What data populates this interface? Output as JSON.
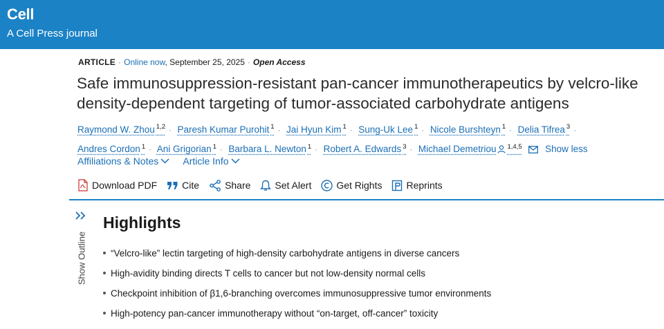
{
  "header": {
    "brand": "Cell",
    "subtitle": "A Cell Press journal",
    "bg_color": "#1b82c6"
  },
  "meta": {
    "type": "ARTICLE",
    "online_label": "Online now",
    "date": ", September 25, 2025",
    "access": "Open Access"
  },
  "title": "Safe immunosuppression-resistant pan-cancer immunotherapeutics by velcro-like density-dependent targeting of tumor-associated carbohydrate antigens",
  "authors": [
    {
      "name": "Raymond W. Zhou",
      "aff": "1,2"
    },
    {
      "name": "Paresh Kumar Purohit",
      "aff": "1"
    },
    {
      "name": "Jai Hyun Kim",
      "aff": "1"
    },
    {
      "name": "Sung-Uk Lee",
      "aff": "1"
    },
    {
      "name": "Nicole Burshteyn",
      "aff": "1"
    },
    {
      "name": "Delia Tifrea",
      "aff": "3"
    },
    {
      "name": "Andres Cordon",
      "aff": "1"
    },
    {
      "name": "Ani Grigorian",
      "aff": "1"
    },
    {
      "name": "Barbara L. Newton",
      "aff": "1"
    },
    {
      "name": "Robert A. Edwards",
      "aff": "3"
    },
    {
      "name": "Michael Demetriou",
      "aff": "1,4,5"
    }
  ],
  "show_less": "Show less",
  "links": {
    "affiliations": "Affiliations & Notes",
    "article_info": "Article Info"
  },
  "tools": {
    "download_pdf": "Download PDF",
    "cite": "Cite",
    "share": "Share",
    "set_alert": "Set Alert",
    "get_rights": "Get Rights",
    "reprints": "Reprints"
  },
  "outline": {
    "label": "Show Outline",
    "toggle_icon": "double-chevron-right-icon"
  },
  "highlights": {
    "title": "Highlights",
    "items": [
      "“Velcro-like” lectin targeting of high-density carbohydrate antigens in diverse cancers",
      "High-avidity binding directs T cells to cancer but not low-density normal cells",
      "Checkpoint inhibition of β1,6-branching overcomes immunosuppressive tumor environments",
      "High-potency pan-cancer immunotherapy without “on-target, off-cancer” toxicity"
    ]
  }
}
